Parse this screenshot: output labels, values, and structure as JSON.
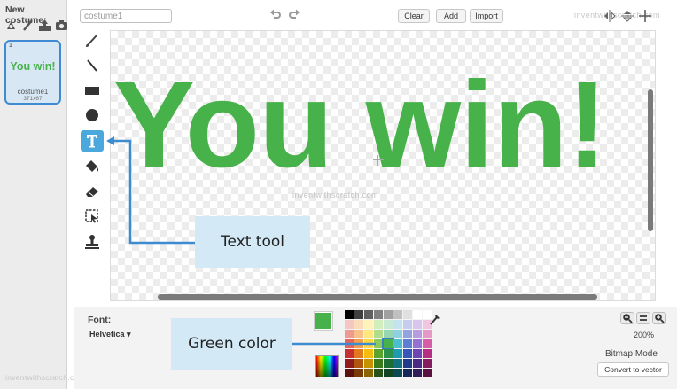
{
  "sidebar": {
    "new_costume_label": "New costume:",
    "new_costume_icons": [
      "paint-from-library-icon",
      "paint-brush-icon",
      "upload-icon",
      "camera-icon"
    ],
    "costume": {
      "number": "1",
      "thumbnail_text": "You win!",
      "name": "costume1",
      "size": "371x67"
    },
    "watermark": "inventwithscratch.com"
  },
  "toolbar": {
    "costume_name_value": "costume1",
    "clear_label": "Clear",
    "add_label": "Add",
    "import_label": "Import",
    "watermark": "inventwithscratch.com"
  },
  "tools": [
    {
      "name": "brush-tool",
      "icon": "brush-icon"
    },
    {
      "name": "line-tool",
      "icon": "line-icon"
    },
    {
      "name": "rectangle-tool",
      "icon": "rectangle-icon"
    },
    {
      "name": "ellipse-tool",
      "icon": "ellipse-icon"
    },
    {
      "name": "text-tool",
      "icon": "text-icon",
      "label": "T",
      "selected": true
    },
    {
      "name": "fill-tool",
      "icon": "paint-bucket-icon"
    },
    {
      "name": "eraser-tool",
      "icon": "eraser-icon"
    },
    {
      "name": "select-tool",
      "icon": "select-icon"
    },
    {
      "name": "stamp-tool",
      "icon": "stamp-icon"
    }
  ],
  "canvas": {
    "text": "You win!",
    "text_color": "#47b14a",
    "watermark": "inventwithscratch.com"
  },
  "callouts": {
    "text_tool": "Text tool",
    "green_color": "Green color"
  },
  "bottom": {
    "font_label": "Font:",
    "font_value": "Helvetica ▾",
    "selected_color": "#47b14a",
    "zoom_level": "200%",
    "mode_label": "Bitmap Mode",
    "convert_label": "Convert to vector"
  },
  "palette": [
    "#000000",
    "#404040",
    "#606060",
    "#808080",
    "#a0a0a0",
    "#c0c0c0",
    "#e0e0e0",
    "#ffffff",
    "#ffffff",
    "#f4c7c3",
    "#fbdcb8",
    "#fff2bb",
    "#d4edbc",
    "#c9ead5",
    "#c3e4ee",
    "#c5cdee",
    "#d9c5ee",
    "#f1c5e2",
    "#ee9a91",
    "#f7c088",
    "#ffe680",
    "#b1dc8c",
    "#96d6b0",
    "#8dd1e0",
    "#91a4e0",
    "#b99be0",
    "#e499c8",
    "#e6635a",
    "#f29e4c",
    "#ffd740",
    "#8ccb5a",
    "#47b14a",
    "#4bbecf",
    "#5c7fd3",
    "#9770d3",
    "#d65ea6",
    "#c63030",
    "#e2791d",
    "#f2bd0f",
    "#5aa42d",
    "#2d9249",
    "#1f9bb0",
    "#3457b8",
    "#6f45b4",
    "#b52e84",
    "#8e1c1c",
    "#b0560f",
    "#c79200",
    "#3b7a1c",
    "#1d6c33",
    "#12707f",
    "#213a87",
    "#4b2a85",
    "#851c5f",
    "#5c1010",
    "#7a3a08",
    "#8a6500",
    "#27521a",
    "#124622",
    "#0b4a55",
    "#15265b",
    "#321c59",
    "#59123f"
  ]
}
